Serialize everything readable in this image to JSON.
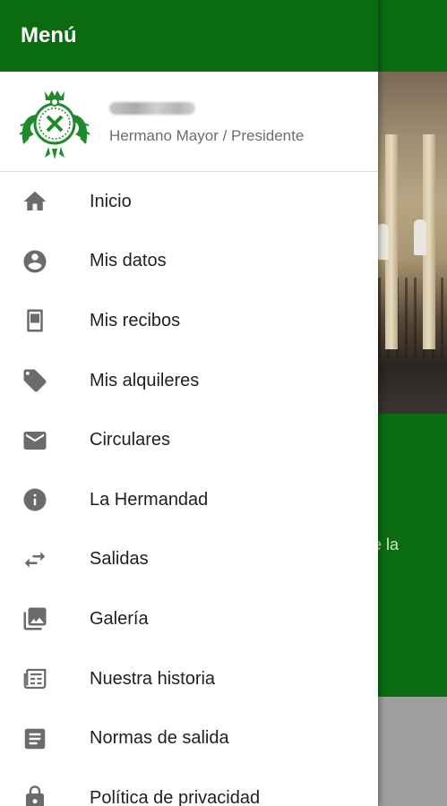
{
  "drawer": {
    "title": "Menú",
    "profile": {
      "role": "Hermano Mayor / Presidente"
    }
  },
  "menu": {
    "items": [
      {
        "label": "Inicio",
        "icon": "home-icon"
      },
      {
        "label": "Mis datos",
        "icon": "account-circle-icon"
      },
      {
        "label": "Mis recibos",
        "icon": "receipt-icon"
      },
      {
        "label": "Mis alquileres",
        "icon": "tag-icon"
      },
      {
        "label": "Circulares",
        "icon": "mail-icon"
      },
      {
        "label": "La Hermandad",
        "icon": "info-icon"
      },
      {
        "label": "Salidas",
        "icon": "swap-arrows-icon"
      },
      {
        "label": "Galería",
        "icon": "gallery-icon"
      },
      {
        "label": "Nuestra historia",
        "icon": "newspaper-icon"
      },
      {
        "label": "Normas de salida",
        "icon": "article-icon"
      },
      {
        "label": "Política de privacidad",
        "icon": "lock-icon"
      }
    ]
  },
  "background": {
    "partial_text": "le la"
  },
  "colors": {
    "primary": "#0a6b10",
    "icon_gray": "#6b6b6b",
    "text": "#1f1f1f",
    "secondary_text": "#6d6d6d"
  }
}
